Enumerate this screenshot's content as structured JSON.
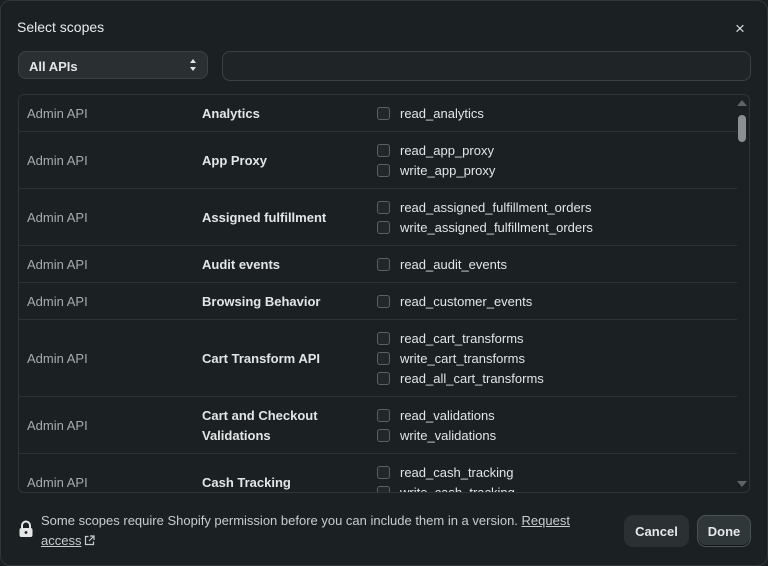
{
  "dialog": {
    "title": "Select scopes",
    "close_icon": "close-icon",
    "close_glyph": "×"
  },
  "filter": {
    "selected": "All APIs",
    "search_value": "",
    "search_placeholder": ""
  },
  "rows": [
    {
      "api": "Admin API",
      "name": "Analytics",
      "scopes": [
        "read_analytics"
      ]
    },
    {
      "api": "Admin API",
      "name": "App Proxy",
      "scopes": [
        "read_app_proxy",
        "write_app_proxy"
      ]
    },
    {
      "api": "Admin API",
      "name": "Assigned fulfillment",
      "scopes": [
        "read_assigned_fulfillment_orders",
        "write_assigned_fulfillment_orders"
      ]
    },
    {
      "api": "Admin API",
      "name": "Audit events",
      "scopes": [
        "read_audit_events"
      ]
    },
    {
      "api": "Admin API",
      "name": "Browsing Behavior",
      "scopes": [
        "read_customer_events"
      ]
    },
    {
      "api": "Admin API",
      "name": "Cart Transform API",
      "scopes": [
        "read_cart_transforms",
        "write_cart_transforms",
        "read_all_cart_transforms"
      ]
    },
    {
      "api": "Admin API",
      "name": "Cart and Checkout Validations",
      "scopes": [
        "read_validations",
        "write_validations"
      ]
    },
    {
      "api": "Admin API",
      "name": "Cash Tracking",
      "scopes": [
        "read_cash_tracking",
        "write_cash_tracking"
      ]
    }
  ],
  "footer": {
    "notice": "Some scopes require Shopify permission before you can include them in a version.",
    "link_word1": "Request",
    "link_word2": "access",
    "cancel_label": "Cancel",
    "done_label": "Done"
  },
  "colors": {
    "background": "#1b2123",
    "text": "#e3e5e6",
    "muted": "#a6acad",
    "border": "#30383a"
  }
}
